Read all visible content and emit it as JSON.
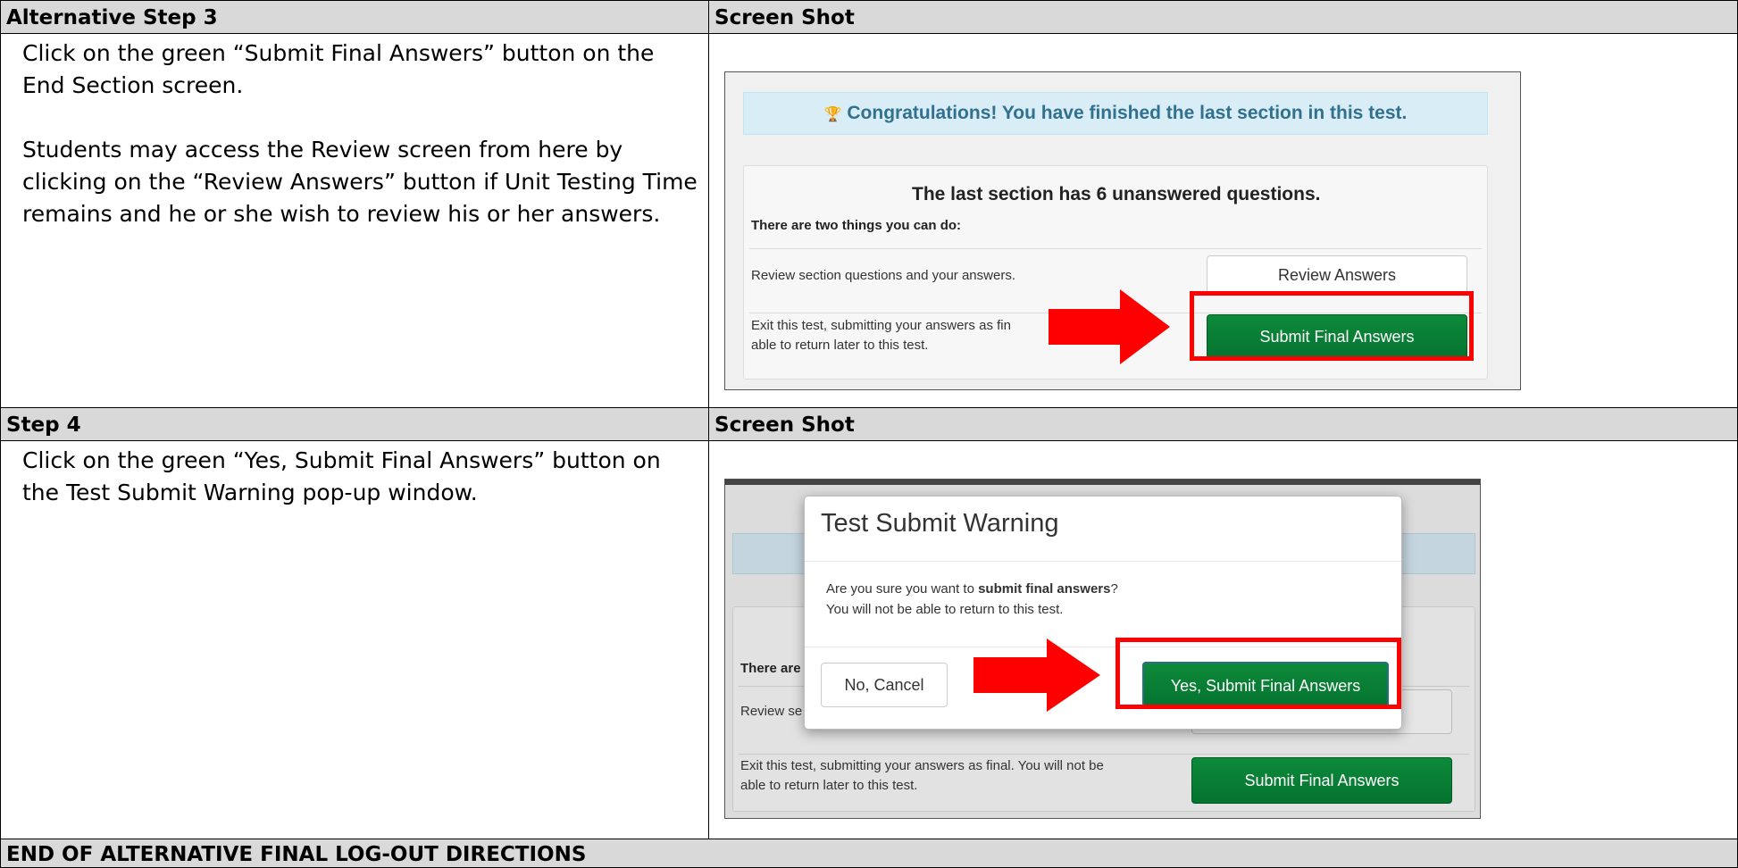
{
  "section1": {
    "header_left": "Alternative Step 3",
    "header_right": "Screen Shot",
    "instruction_1": "Click on the green “Submit Final Answers” button on the End Section screen.",
    "instruction_2": "Students may access the Review screen from here by clicking on the “Review Answers” button if Unit Testing Time remains and he or she wish to review his or her answers.",
    "screenshot": {
      "banner": "Congratulations! You have finished the last section in this test.",
      "banner_icon": "trophy-icon",
      "panel_title": "The last section has 6 unanswered questions.",
      "subhead": "There are two things you can do:",
      "row1_text": "Review section questions and your answers.",
      "row1_button": "Review Answers",
      "row2_text_line1": "Exit this test, submitting your answers as fin",
      "row2_text_line2": "able to return later to this test.",
      "row2_button": "Submit Final Answers",
      "highlight_color": "#ff0000"
    }
  },
  "section2": {
    "header_left": "Step 4",
    "header_right": "Screen Shot",
    "instruction_1": "Click on the green “Yes, Submit Final Answers” button on the Test Submit Warning pop-up window.",
    "screenshot": {
      "modal_title": "Test Submit Warning",
      "body_pre": "Are you sure you want to ",
      "body_bold": "submit final answers",
      "body_post": "?",
      "body_line2": "You will not be able to return to this test.",
      "cancel_button": "No, Cancel",
      "confirm_button": "Yes, Submit Final Answers",
      "bg_subhead_fragment": "There are",
      "bg_row1_fragment": "Review se",
      "bg_row2_line1": "Exit this test, submitting your answers as final. You will not be",
      "bg_row2_line2": "able to return later to this test.",
      "bg_button": "Submit Final Answers"
    }
  },
  "footer": {
    "text": "END OF ALTERNATIVE FINAL LOG-OUT DIRECTIONS"
  }
}
